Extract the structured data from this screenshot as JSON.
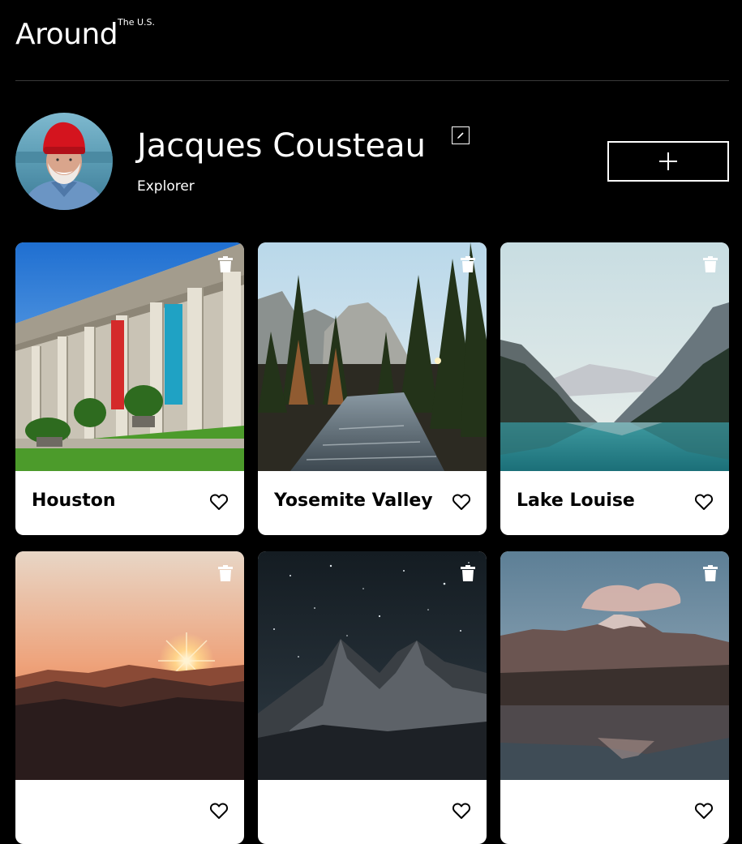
{
  "header": {
    "logo": "Around",
    "logo_sup": "The U.S."
  },
  "profile": {
    "name": "Jacques Cousteau",
    "role": "Explorer"
  },
  "icons": {
    "edit": "pencil-icon",
    "add": "plus-icon",
    "delete": "trash-icon",
    "like": "heart-icon"
  },
  "cards": [
    {
      "title": "Houston",
      "liked": false
    },
    {
      "title": "Yosemite Valley",
      "liked": false
    },
    {
      "title": "Lake Louise",
      "liked": false
    },
    {
      "title": "",
      "liked": false
    },
    {
      "title": "",
      "liked": false
    },
    {
      "title": "",
      "liked": false
    }
  ],
  "colors": {
    "background": "#000000",
    "card": "#ffffff",
    "divider": "#3a3a3a",
    "text": "#ffffff",
    "card_text": "#000000"
  }
}
